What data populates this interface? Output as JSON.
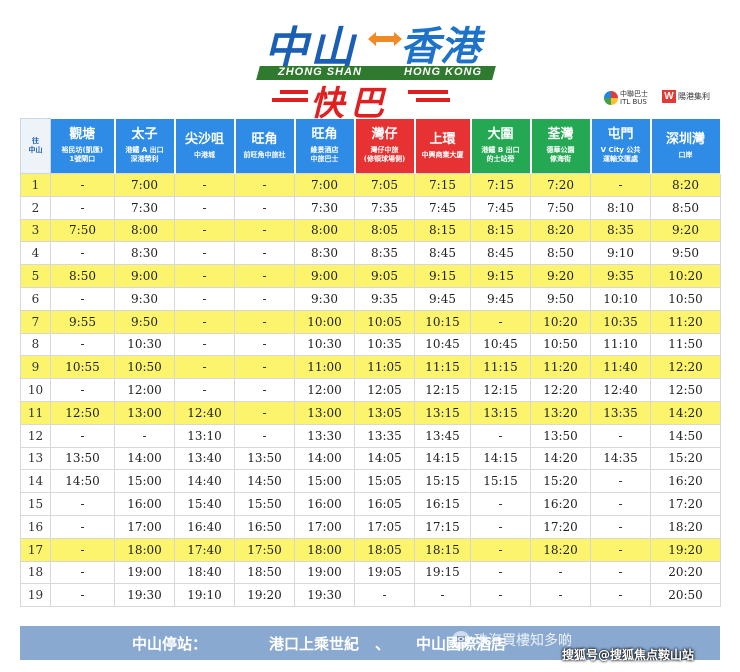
{
  "header": {
    "title_left": "中山",
    "title_right": "香港",
    "sub_left": "ZHONG SHAN",
    "sub_right": "HONG KONG",
    "bus_word": "快巴",
    "partner1": "中聯巴士",
    "partner1_sub": "ITL BUS",
    "partner2": "陽港集利"
  },
  "corner_label": "往\n中山",
  "stations": [
    {
      "name": "觀塘",
      "note": "裕民坊(凱匯)\n1號閘口",
      "color": "blue"
    },
    {
      "name": "太子",
      "note": "港鐵 A 出口\n深港榮利",
      "color": "blue"
    },
    {
      "name": "尖沙咀",
      "note": "中港城",
      "color": "blue"
    },
    {
      "name": "旺角",
      "note": "前旺角中旅社",
      "color": "blue"
    },
    {
      "name": "旺角",
      "note": "維景酒店\n中旅巴士",
      "color": "blue"
    },
    {
      "name": "灣仔",
      "note": "灣仔中旅\n(修頓球場側)",
      "color": "red"
    },
    {
      "name": "上環",
      "note": "中興商業大廈",
      "color": "red"
    },
    {
      "name": "大圍",
      "note": "港鐵 B 出口\n的士站旁",
      "color": "green"
    },
    {
      "name": "荃灣",
      "note": "德華公園\n傢海街",
      "color": "green"
    },
    {
      "name": "屯門",
      "note": "V City 公共\n運輸交匯處",
      "color": "blue"
    },
    {
      "name": "深圳灣",
      "note": "口岸",
      "color": "blue"
    }
  ],
  "rows": [
    {
      "no": "1",
      "times": [
        "-",
        "7:00",
        "-",
        "-",
        "7:00",
        "7:05",
        "7:15",
        "7:15",
        "7:20",
        "-",
        "8:20"
      ]
    },
    {
      "no": "2",
      "times": [
        "-",
        "7:30",
        "-",
        "-",
        "7:30",
        "7:35",
        "7:45",
        "7:45",
        "7:50",
        "8:10",
        "8:50"
      ]
    },
    {
      "no": "3",
      "times": [
        "7:50",
        "8:00",
        "-",
        "-",
        "8:00",
        "8:05",
        "8:15",
        "8:15",
        "8:20",
        "8:35",
        "9:20"
      ]
    },
    {
      "no": "4",
      "times": [
        "-",
        "8:30",
        "-",
        "-",
        "8:30",
        "8:35",
        "8:45",
        "8:45",
        "8:50",
        "9:10",
        "9:50"
      ]
    },
    {
      "no": "5",
      "times": [
        "8:50",
        "9:00",
        "-",
        "-",
        "9:00",
        "9:05",
        "9:15",
        "9:15",
        "9:20",
        "9:35",
        "10:20"
      ]
    },
    {
      "no": "6",
      "times": [
        "-",
        "9:30",
        "-",
        "-",
        "9:30",
        "9:35",
        "9:45",
        "9:45",
        "9:50",
        "10:10",
        "10:50"
      ]
    },
    {
      "no": "7",
      "times": [
        "9:55",
        "9:50",
        "-",
        "-",
        "10:00",
        "10:05",
        "10:15",
        "-",
        "10:20",
        "10:35",
        "11:20"
      ]
    },
    {
      "no": "8",
      "times": [
        "-",
        "10:30",
        "-",
        "-",
        "10:30",
        "10:35",
        "10:45",
        "10:45",
        "10:50",
        "11:10",
        "11:50"
      ]
    },
    {
      "no": "9",
      "times": [
        "10:55",
        "10:50",
        "-",
        "-",
        "11:00",
        "11:05",
        "11:15",
        "11:15",
        "11:20",
        "11:40",
        "12:20"
      ]
    },
    {
      "no": "10",
      "times": [
        "-",
        "12:00",
        "-",
        "-",
        "12:00",
        "12:05",
        "12:15",
        "12:15",
        "12:20",
        "12:40",
        "12:50"
      ]
    },
    {
      "no": "11",
      "times": [
        "12:50",
        "13:00",
        "12:40",
        "-",
        "13:00",
        "13:05",
        "13:15",
        "13:15",
        "13:20",
        "13:35",
        "14:20"
      ]
    },
    {
      "no": "12",
      "times": [
        "-",
        "-",
        "13:10",
        "-",
        "13:30",
        "13:35",
        "13:45",
        "-",
        "13:50",
        "-",
        "14:50"
      ]
    },
    {
      "no": "13",
      "times": [
        "13:50",
        "14:00",
        "13:40",
        "13:50",
        "14:00",
        "14:05",
        "14:15",
        "14:15",
        "14:20",
        "14:35",
        "15:20"
      ]
    },
    {
      "no": "14",
      "times": [
        "14:50",
        "15:00",
        "14:40",
        "14:50",
        "15:00",
        "15:05",
        "15:15",
        "15:15",
        "15:20",
        "-",
        "16:20"
      ]
    },
    {
      "no": "15",
      "times": [
        "-",
        "16:00",
        "15:40",
        "15:50",
        "16:00",
        "16:05",
        "16:15",
        "-",
        "16:20",
        "-",
        "17:20"
      ]
    },
    {
      "no": "16",
      "times": [
        "-",
        "17:00",
        "16:40",
        "16:50",
        "17:00",
        "17:05",
        "17:15",
        "-",
        "17:20",
        "-",
        "18:20"
      ]
    },
    {
      "no": "17",
      "times": [
        "-",
        "18:00",
        "17:40",
        "17:50",
        "18:00",
        "18:05",
        "18:15",
        "-",
        "18:20",
        "-",
        "19:20"
      ]
    },
    {
      "no": "18",
      "times": [
        "-",
        "19:00",
        "18:40",
        "18:50",
        "19:00",
        "19:05",
        "19:15",
        "-",
        "-",
        "-",
        "20:20"
      ]
    },
    {
      "no": "19",
      "times": [
        "-",
        "19:30",
        "19:10",
        "19:20",
        "19:30",
        "-",
        "-",
        "-",
        "-",
        "-",
        "20:50"
      ]
    }
  ],
  "highlight_rows": [
    "1",
    "3",
    "5",
    "7",
    "9",
    "11",
    "17"
  ],
  "footer": {
    "label": "中山停站：",
    "stop1": "港口上乘世紀",
    "sep": "、",
    "stop2": "中山國際酒店"
  },
  "watermark": {
    "text": "珠海買樓知多啲",
    "corner": "搜狐号@搜狐焦点鞍山站"
  }
}
